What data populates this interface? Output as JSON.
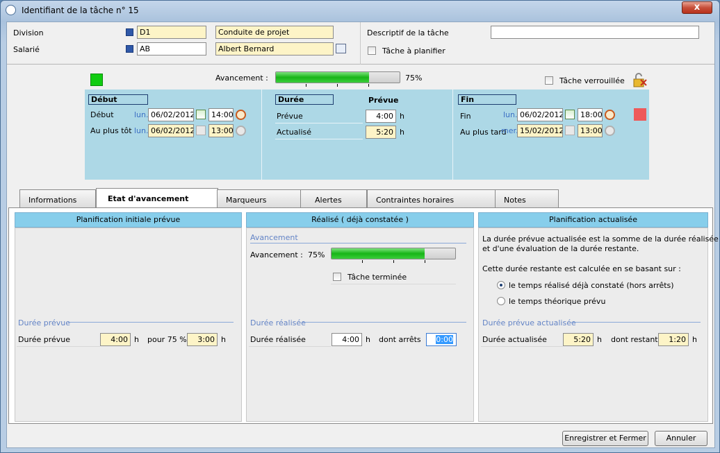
{
  "window": {
    "title": "Identifiant de la tâche n° 15",
    "close": "x"
  },
  "header": {
    "division_label": "Division",
    "division_code": "D1",
    "division_name": "Conduite de projet",
    "salarie_label": "Salarié",
    "salarie_code": "AB",
    "salarie_name": "Albert Bernard",
    "descriptif_label": "Descriptif de la tâche",
    "descriptif_value": "",
    "planifier_label": "Tâche à planifier"
  },
  "top": {
    "avancement_label": "Avancement :",
    "avancement_pct": "75%",
    "avancement_value": 0.75,
    "verrou_label": "Tâche verrouillée",
    "status_color": "#11cc11",
    "fin_color": "#ee5a5a"
  },
  "debut": {
    "title": "Début",
    "row1_label": "Début",
    "row1_day": "lun.",
    "row1_date": "06/02/2012",
    "row1_time": "14:00",
    "row2_label": "Au plus tôt",
    "row2_day": "lun.",
    "row2_date": "06/02/2012",
    "row2_time": "13:00"
  },
  "duree": {
    "title": "Durée",
    "prevue_col": "Prévue",
    "row1_label": "Prévue",
    "row1_value": "4:00",
    "row1_unit": "h",
    "row2_label": "Actualisé",
    "row2_value": "5:20",
    "row2_unit": "h"
  },
  "fin": {
    "title": "Fin",
    "row1_label": "Fin",
    "row1_day": "lun.",
    "row1_date": "06/02/2012",
    "row1_time": "18:00",
    "row2_label": "Au plus tard",
    "row2_day": "mer.",
    "row2_date": "15/02/2012",
    "row2_time": "13:00"
  },
  "tabs": [
    "Informations",
    "Etat d'avancement",
    "Marqueurs",
    "Alertes",
    "Contraintes horaires",
    "Notes"
  ],
  "col1": {
    "title": "Planification initiale prévue",
    "group": "Durée prévue",
    "label": "Durée prévue",
    "value": "4:00",
    "unit": "h",
    "pour_label": "pour 75 %",
    "pour_value": "3:00",
    "pour_unit": "h"
  },
  "col2": {
    "title": "Réalisé ( déjà constatée )",
    "group1": "Avancement",
    "avancement_label": "Avancement :",
    "avancement_pct": "75%",
    "avancement_value": 0.75,
    "terminee_label": "Tâche terminée",
    "group2": "Durée réalisée",
    "label": "Durée réalisée",
    "value": "4:00",
    "unit": "h",
    "arrets_label": "dont arrêts",
    "arrets_value": "0:00"
  },
  "col3": {
    "title": "Planification actualisée",
    "text1": "La durée prévue actualisée est la somme de la durée réalisée",
    "text2": "et d'une évaluation de la durée restante.",
    "text3": "Cette durée restante est calculée en se basant sur :",
    "radio1": "le temps réalisé déjà constaté (hors arrêts)",
    "radio2": "le temps théorique prévu",
    "group": "Durée prévue actualisée",
    "label": "Durée actualisée",
    "value": "5:20",
    "unit": "h",
    "restant_label": "dont restant",
    "restant_value": "1:20",
    "restant_unit": "h"
  },
  "footer": {
    "save": "Enregistrer et Fermer",
    "cancel": "Annuler"
  }
}
